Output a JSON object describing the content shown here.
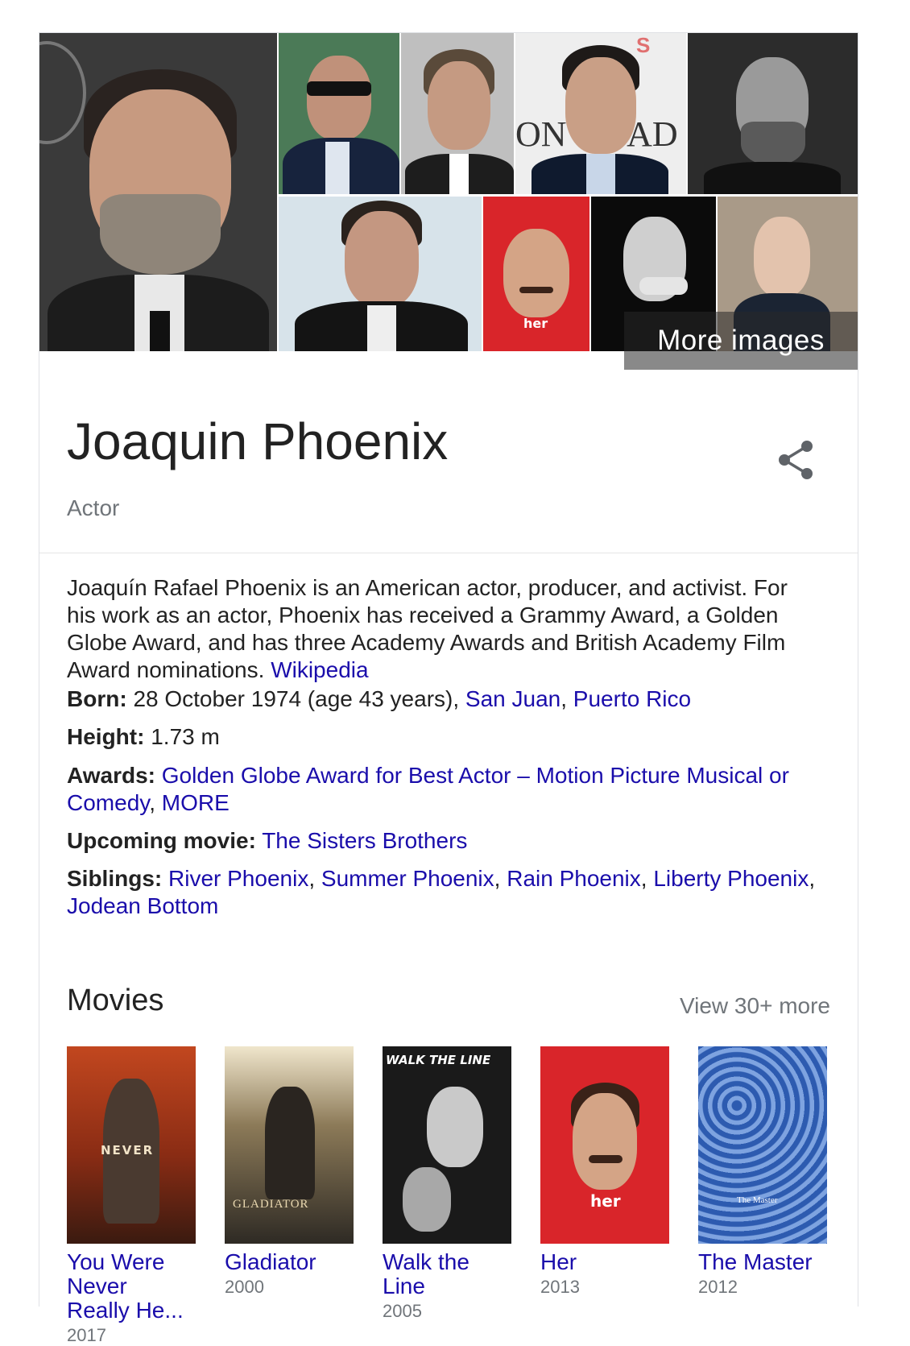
{
  "mosaic": {
    "more_images_label": "More images",
    "poster_her_label": "her"
  },
  "header": {
    "title": "Joaquin Phoenix",
    "subtitle": "Actor"
  },
  "description": {
    "text": "Joaquín Rafael Phoenix is an American actor, producer, and activist. For his work as an actor, Phoenix has received a Grammy Award, a Golden Globe Award, and has three Academy Awards and British Academy Film Award nominations.",
    "source_link": "Wikipedia"
  },
  "facts": {
    "born": {
      "label": "Born:",
      "value": "28 October 1974 (age 43 years),",
      "place_city": "San Juan",
      "place_sep": ",",
      "place_region": "Puerto Rico"
    },
    "height": {
      "label": "Height:",
      "value": "1.73 m"
    },
    "awards": {
      "label": "Awards:",
      "award1": "Golden Globe Award for Best Actor – Motion Picture Musical or Comedy",
      "sep": ",",
      "more": "MORE"
    },
    "upcoming": {
      "label": "Upcoming movie:",
      "movie": "The Sisters Brothers"
    },
    "siblings": {
      "label": "Siblings:",
      "names": [
        "River Phoenix",
        "Summer Phoenix",
        "Rain Phoenix",
        "Liberty Phoenix",
        "Jodean Bottom"
      ],
      "sep": ","
    }
  },
  "movies": {
    "title": "Movies",
    "view_more": "View 30+ more",
    "items": [
      {
        "title": "You Were Never Really He...",
        "year": "2017",
        "poster_text": "NEVER"
      },
      {
        "title": "Gladiator",
        "year": "2000",
        "poster_text": "GLADIATOR"
      },
      {
        "title": "Walk the Line",
        "year": "2005",
        "poster_text": "WALK THE LINE"
      },
      {
        "title": "Her",
        "year": "2013",
        "poster_text": "her"
      },
      {
        "title": "The Master",
        "year": "2012",
        "poster_text": "The Master"
      }
    ]
  },
  "colors": {
    "link": "#1a0dab",
    "muted": "#70757a",
    "text": "#222222",
    "border": "#dfe1e5"
  }
}
